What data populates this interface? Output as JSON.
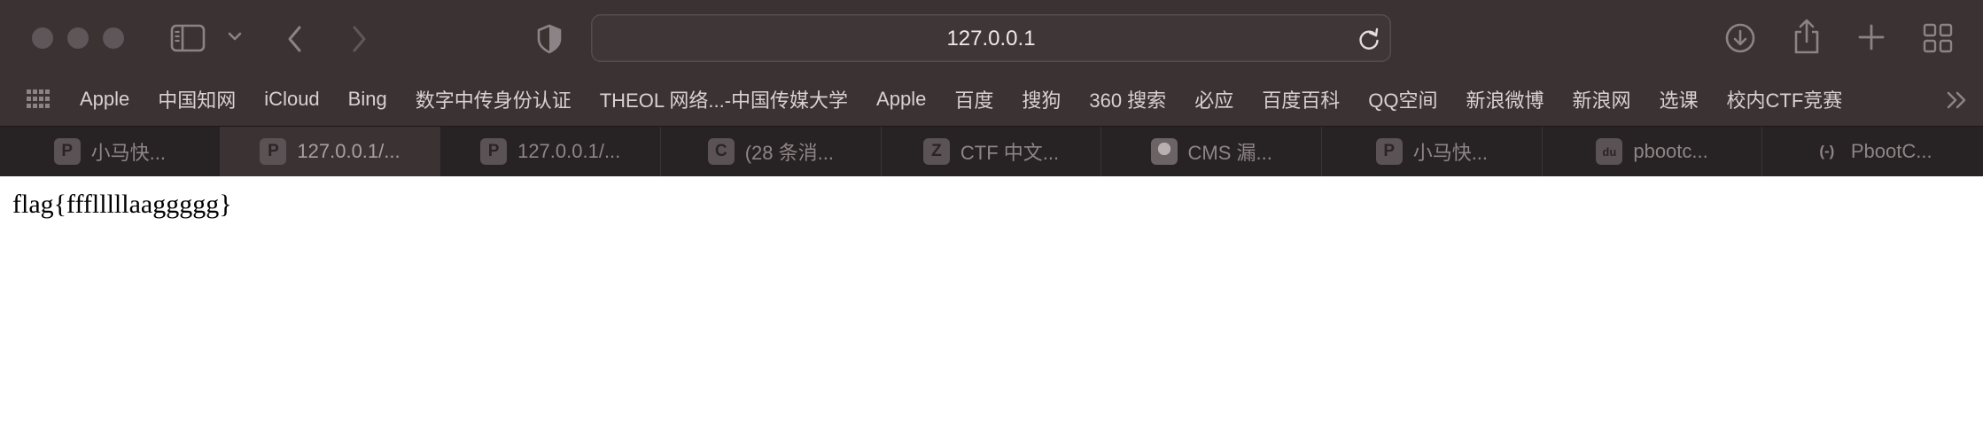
{
  "window": {
    "address": "127.0.0.1"
  },
  "toolbar_icons": {
    "sidebar": "sidebar-icon",
    "tab_group_menu": "chevron-down-icon",
    "back": "chevron-left-icon",
    "forward": "chevron-right-icon",
    "privacy": "shield-icon",
    "reload": "reload-icon",
    "downloads": "download-icon",
    "share": "share-icon",
    "new_tab": "plus-icon",
    "tab_overview": "grid-icon"
  },
  "bookmarks": {
    "items": [
      {
        "label": "Apple"
      },
      {
        "label": "中国知网"
      },
      {
        "label": "iCloud"
      },
      {
        "label": "Bing"
      },
      {
        "label": "数字中传身份认证"
      },
      {
        "label": "THEOL 网络...-中国传媒大学"
      },
      {
        "label": "Apple"
      },
      {
        "label": "百度"
      },
      {
        "label": "搜狗"
      },
      {
        "label": "360 搜索"
      },
      {
        "label": "必应"
      },
      {
        "label": "百度百科"
      },
      {
        "label": "QQ空间"
      },
      {
        "label": "新浪微博"
      },
      {
        "label": "新浪网"
      },
      {
        "label": "选课"
      },
      {
        "label": "校内CTF竞赛"
      }
    ]
  },
  "tabs": [
    {
      "title": "小马快...",
      "favicon": "P",
      "active": false
    },
    {
      "title": "127.0.0.1/...",
      "favicon": "P",
      "active": true
    },
    {
      "title": "127.0.0.1/...",
      "favicon": "P",
      "active": false
    },
    {
      "title": "(28 条消...",
      "favicon": "C",
      "active": false
    },
    {
      "title": "CTF 中文...",
      "favicon": "Z",
      "active": false
    },
    {
      "title": "CMS 漏...",
      "favicon": "",
      "active": false
    },
    {
      "title": "小马快...",
      "favicon": "P",
      "active": false
    },
    {
      "title": "pbootc...",
      "favicon": "du",
      "active": false
    },
    {
      "title": "PbootC...",
      "favicon": "(-)",
      "active": false
    }
  ],
  "page": {
    "body_text": "flag{ffflllllaaggggg}"
  },
  "colors": {
    "chrome_bg": "#3b3234",
    "tabstrip_bg": "#272223",
    "page_bg": "#ffffff"
  }
}
